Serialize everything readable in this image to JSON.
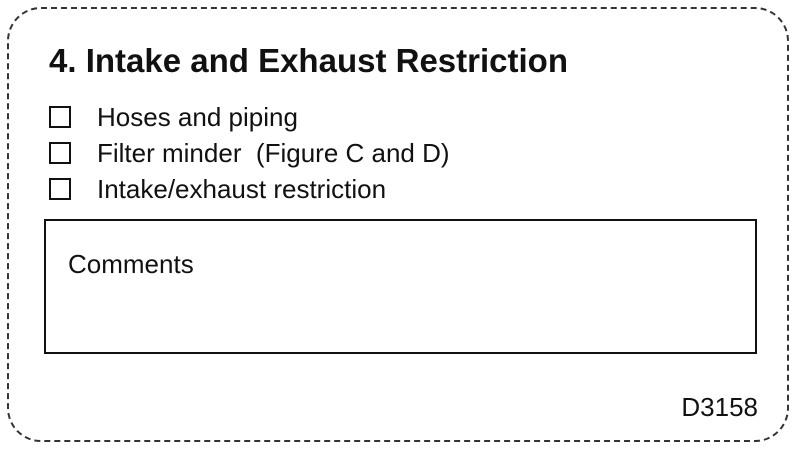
{
  "title": "4. Intake and Exhaust Restriction",
  "checklist": [
    {
      "label": "Hoses and piping",
      "checked": false
    },
    {
      "label": "Filter minder  (Figure C and D)",
      "checked": false
    },
    {
      "label": "Intake/exhaust restriction",
      "checked": false
    }
  ],
  "comments": {
    "label": "Comments"
  },
  "doc_code": "D3158"
}
